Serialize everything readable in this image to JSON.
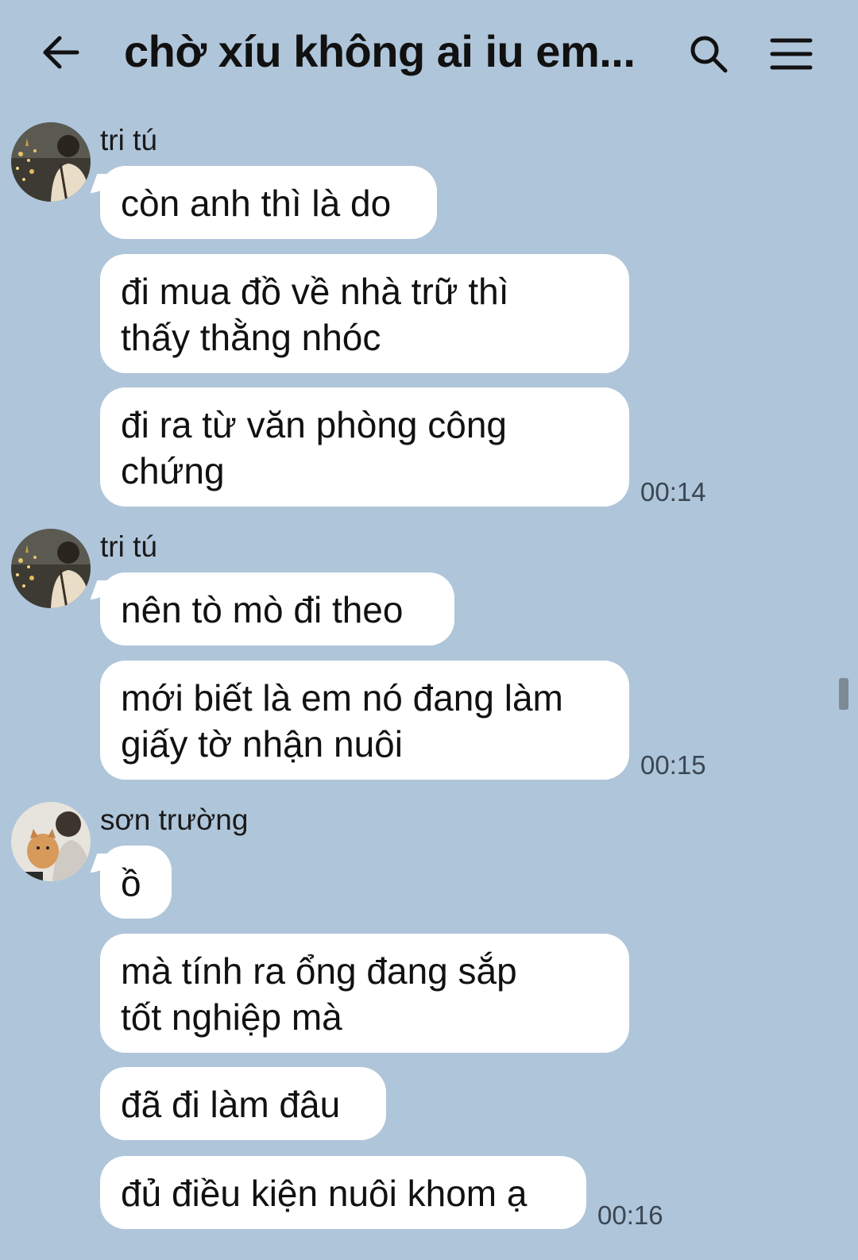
{
  "header": {
    "title": "chờ xíu không ai iu em...",
    "back_icon": "arrow-left-icon",
    "search_icon": "search-icon",
    "menu_icon": "hamburger-menu-icon"
  },
  "messages": [
    {
      "sender": "tri tú",
      "bubbles": [
        "còn anh thì là do",
        "đi mua đồ về nhà trữ thì\nthấy thằng nhóc",
        "đi ra từ văn phòng công\nchứng"
      ],
      "time": "00:14"
    },
    {
      "sender": "tri tú",
      "bubbles": [
        "nên tò mò đi theo",
        "mới biết là em nó đang làm\ngiấy tờ nhận nuôi"
      ],
      "time": "00:15"
    },
    {
      "sender": "sơn trường",
      "bubbles": [
        "ồ",
        "mà tính ra ổng đang sắp\ntốt nghiệp mà",
        "đã đi làm đâu",
        "đủ điều kiện nuôi khom ạ"
      ],
      "time": "00:16"
    }
  ],
  "colors": {
    "background": "#afc5da",
    "bubble": "#ffffff",
    "text": "#111111",
    "time": "#3a4652"
  }
}
